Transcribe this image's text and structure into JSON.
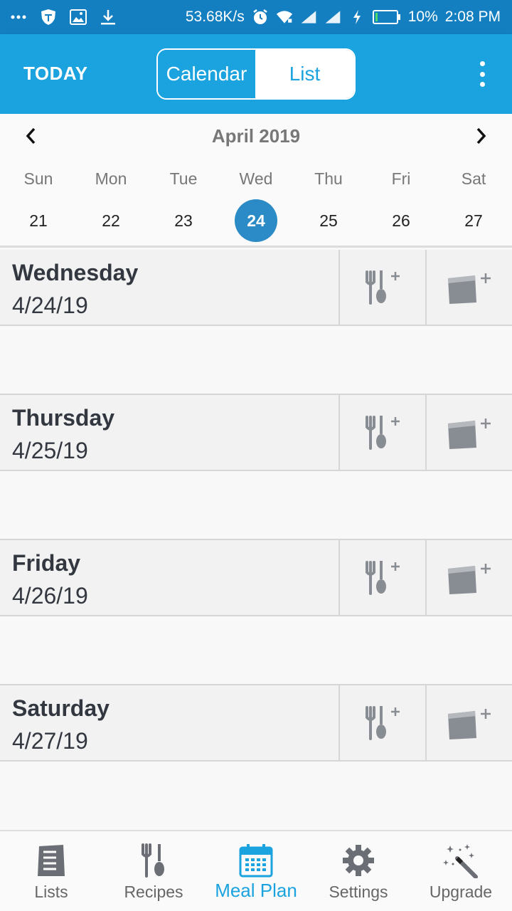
{
  "status_bar": {
    "speed": "53.68K/s",
    "battery": "10%",
    "time": "2:08 PM",
    "icons": [
      "more-dots-icon",
      "shield-icon",
      "image-icon",
      "download-icon",
      "alarm-icon",
      "wifi-icon",
      "signal-icon",
      "signal-icon",
      "charging-icon",
      "battery-icon"
    ]
  },
  "app_bar": {
    "today_label": "TODAY",
    "segments": {
      "calendar": "Calendar",
      "list": "List"
    },
    "selected_segment": "List",
    "menu_icon": "more-vert-icon",
    "accent_color": "#1ba3df"
  },
  "calendar": {
    "month_label": "April 2019",
    "weekdays": [
      "Sun",
      "Mon",
      "Tue",
      "Wed",
      "Thu",
      "Fri",
      "Sat"
    ],
    "dates": [
      "21",
      "22",
      "23",
      "24",
      "25",
      "26",
      "27"
    ],
    "selected_date": "24",
    "selected_color": "#2a8bc6"
  },
  "days": [
    {
      "name": "Wednesday",
      "date": "4/24/19"
    },
    {
      "name": "Thursday",
      "date": "4/25/19"
    },
    {
      "name": "Friday",
      "date": "4/26/19"
    },
    {
      "name": "Saturday",
      "date": "4/27/19"
    }
  ],
  "day_actions": {
    "add_recipe_icon": "add-recipe-icon",
    "add_note_icon": "add-note-icon"
  },
  "bottom_nav": {
    "tabs": [
      {
        "label": "Lists",
        "icon": "lists-icon"
      },
      {
        "label": "Recipes",
        "icon": "recipes-icon"
      },
      {
        "label": "Meal Plan",
        "icon": "calendar-icon"
      },
      {
        "label": "Settings",
        "icon": "gear-icon"
      },
      {
        "label": "Upgrade",
        "icon": "magic-wand-icon"
      }
    ],
    "active_tab": "Meal Plan"
  }
}
